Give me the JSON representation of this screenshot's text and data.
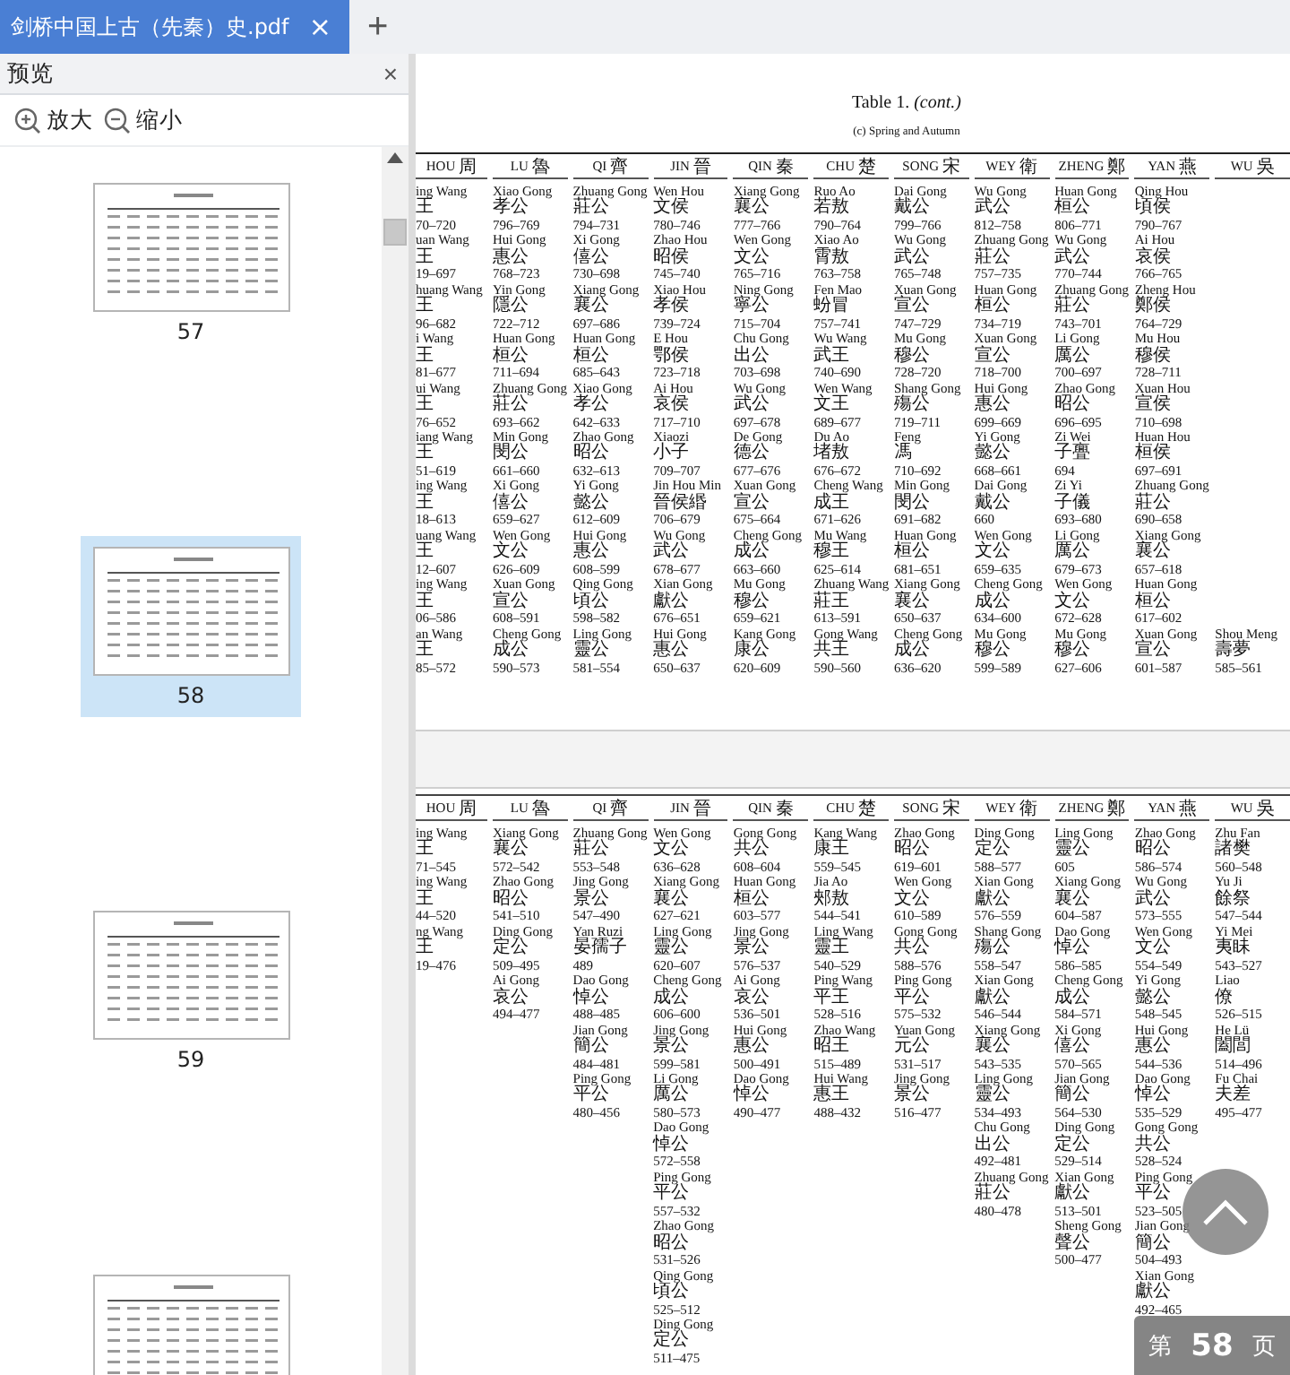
{
  "tabs": [
    {
      "title": "剑桥中国上古（先秦）史.pdf",
      "close": "×",
      "selected": true
    }
  ],
  "new_tab": "+",
  "sidebar": {
    "title": "预览",
    "close": "×",
    "tools": [
      {
        "kind": "zoom-in",
        "label": "放大"
      },
      {
        "kind": "zoom-out",
        "label": "缩小"
      }
    ],
    "thumbnails": [
      {
        "label": "57",
        "selected": false
      },
      {
        "label": "58",
        "selected": true
      },
      {
        "label": "59",
        "selected": false
      },
      {
        "selected": false
      }
    ]
  },
  "pages": [
    {
      "title": "Table 1. *(cont.)*",
      "subtitle": "(c) Spring and Autumn",
      "columns": [
        {
          "state": "HOU",
          "zh": "周",
          "entries": [
            [
              "ing Wang",
              "王",
              "70–720"
            ],
            [
              "uan Wang",
              "王",
              "19–697"
            ],
            [
              "huang Wang",
              "王",
              "96–682"
            ],
            [
              "i Wang",
              "王",
              "81–677"
            ],
            [
              "ui Wang",
              "王",
              "76–652"
            ],
            [
              "iang Wang",
              "王",
              "51–619"
            ],
            [
              "ing Wang",
              "王",
              "18–613"
            ],
            [
              "uang Wang",
              "王",
              "12–607"
            ],
            [
              "ing Wang",
              "王",
              "06–586"
            ],
            [
              "an Wang",
              "王",
              "85–572"
            ]
          ]
        },
        {
          "state": "LU",
          "zh": "魯",
          "entries": [
            [
              "Xiao Gong",
              "孝公",
              "796–769"
            ],
            [
              "Hui Gong",
              "惠公",
              "768–723"
            ],
            [
              "Yin Gong",
              "隱公",
              "722–712"
            ],
            [
              "Huan Gong",
              "桓公",
              "711–694"
            ],
            [
              "Zhuang Gong",
              "莊公",
              "693–662"
            ],
            [
              "Min Gong",
              "閔公",
              "661–660"
            ],
            [
              "Xi Gong",
              "僖公",
              "659–627"
            ],
            [
              "Wen Gong",
              "文公",
              "626–609"
            ],
            [
              "Xuan Gong",
              "宣公",
              "608–591"
            ],
            [
              "Cheng Gong",
              "成公",
              "590–573"
            ]
          ]
        },
        {
          "state": "QI",
          "zh": "齊",
          "entries": [
            [
              "Zhuang Gong",
              "莊公",
              "794–731"
            ],
            [
              "Xi Gong",
              "僖公",
              "730–698"
            ],
            [
              "Xiang Gong",
              "襄公",
              "697–686"
            ],
            [
              "Huan Gong",
              "桓公",
              "685–643"
            ],
            [
              "Xiao Gong",
              "孝公",
              "642–633"
            ],
            [
              "Zhao Gong",
              "昭公",
              "632–613"
            ],
            [
              "Yi Gong",
              "懿公",
              "612–609"
            ],
            [
              "Hui Gong",
              "惠公",
              "608–599"
            ],
            [
              "Qing Gong",
              "頃公",
              "598–582"
            ],
            [
              "Ling Gong",
              "靈公",
              "581–554"
            ]
          ]
        },
        {
          "state": "JIN",
          "zh": "晉",
          "entries": [
            [
              "Wen Hou",
              "文侯",
              "780–746"
            ],
            [
              "Zhao Hou",
              "昭侯",
              "745–740"
            ],
            [
              "Xiao Hou",
              "孝侯",
              "739–724"
            ],
            [
              "E Hou",
              "鄂侯",
              "723–718"
            ],
            [
              "Ai Hou",
              "哀侯",
              "717–710"
            ],
            [
              "Xiaozi",
              "小子",
              "709–707"
            ],
            [
              "Jin Hou Min",
              "晉侯緡",
              "706–679"
            ],
            [
              "Wu Gong",
              "武公",
              "678–677"
            ],
            [
              "Xian Gong",
              "獻公",
              "676–651"
            ],
            [
              "Hui Gong",
              "惠公",
              "650–637"
            ]
          ]
        },
        {
          "state": "QIN",
          "zh": "秦",
          "entries": [
            [
              "Xiang Gong",
              "襄公",
              "777–766"
            ],
            [
              "Wen Gong",
              "文公",
              "765–716"
            ],
            [
              "Ning Gong",
              "寧公",
              "715–704"
            ],
            [
              "Chu Gong",
              "出公",
              "703–698"
            ],
            [
              "Wu Gong",
              "武公",
              "697–678"
            ],
            [
              "De Gong",
              "德公",
              "677–676"
            ],
            [
              "Xuan Gong",
              "宣公",
              "675–664"
            ],
            [
              "Cheng Gong",
              "成公",
              "663–660"
            ],
            [
              "Mu Gong",
              "穆公",
              "659–621"
            ],
            [
              "Kang Gong",
              "康公",
              "620–609"
            ]
          ]
        },
        {
          "state": "CHU",
          "zh": "楚",
          "entries": [
            [
              "Ruo Ao",
              "若敖",
              "790–764"
            ],
            [
              "Xiao Ao",
              "霄敖",
              "763–758"
            ],
            [
              "Fen Mao",
              "蚡冒",
              "757–741"
            ],
            [
              "Wu Wang",
              "武王",
              "740–690"
            ],
            [
              "Wen Wang",
              "文王",
              "689–677"
            ],
            [
              "Du Ao",
              "堵敖",
              "676–672"
            ],
            [
              "Cheng Wang",
              "成王",
              "671–626"
            ],
            [
              "Mu Wang",
              "穆王",
              "625–614"
            ],
            [
              "Zhuang Wang",
              "莊王",
              "613–591"
            ],
            [
              "Gong Wang",
              "共王",
              "590–560"
            ]
          ]
        },
        {
          "state": "SONG",
          "zh": "宋",
          "entries": [
            [
              "Dai Gong",
              "戴公",
              "799–766"
            ],
            [
              "Wu Gong",
              "武公",
              "765–748"
            ],
            [
              "Xuan Gong",
              "宣公",
              "747–729"
            ],
            [
              "Mu Gong",
              "穆公",
              "728–720"
            ],
            [
              "Shang Gong",
              "殤公",
              "719–711"
            ],
            [
              "Feng",
              "馮",
              "710–692"
            ],
            [
              "Min Gong",
              "閔公",
              "691–682"
            ],
            [
              "Huan Gong",
              "桓公",
              "681–651"
            ],
            [
              "Xiang Gong",
              "襄公",
              "650–637"
            ],
            [
              "Cheng Gong",
              "成公",
              "636–620"
            ]
          ]
        },
        {
          "state": "WEY",
          "zh": "衛",
          "entries": [
            [
              "Wu Gong",
              "武公",
              "812–758"
            ],
            [
              "Zhuang Gong",
              "莊公",
              "757–735"
            ],
            [
              "Huan Gong",
              "桓公",
              "734–719"
            ],
            [
              "Xuan Gong",
              "宣公",
              "718–700"
            ],
            [
              "Hui Gong",
              "惠公",
              "699–669"
            ],
            [
              "Yi Gong",
              "懿公",
              "668–661"
            ],
            [
              "Dai Gong",
              "戴公",
              "660"
            ],
            [
              "Wen Gong",
              "文公",
              "659–635"
            ],
            [
              "Cheng Gong",
              "成公",
              "634–600"
            ],
            [
              "Mu Gong",
              "穆公",
              "599–589"
            ]
          ]
        },
        {
          "state": "ZHENG",
          "zh": "鄭",
          "entries": [
            [
              "Huan Gong",
              "桓公",
              "806–771"
            ],
            [
              "Wu Gong",
              "武公",
              "770–744"
            ],
            [
              "Zhuang Gong",
              "莊公",
              "743–701"
            ],
            [
              "Li Gong",
              "厲公",
              "700–697"
            ],
            [
              "Zhao Gong",
              "昭公",
              "696–695"
            ],
            [
              "Zi Wei",
              "子亹",
              "694"
            ],
            [
              "Zi Yi",
              "子儀",
              "693–680"
            ],
            [
              "Li Gong",
              "厲公",
              "679–673"
            ],
            [
              "Wen Gong",
              "文公",
              "672–628"
            ],
            [
              "Mu Gong",
              "穆公",
              "627–606"
            ]
          ]
        },
        {
          "state": "YAN",
          "zh": "燕",
          "entries": [
            [
              "Qing Hou",
              "頃侯",
              "790–767"
            ],
            [
              "Ai Hou",
              "哀侯",
              "766–765"
            ],
            [
              "Zheng Hou",
              "鄭侯",
              "764–729"
            ],
            [
              "Mu Hou",
              "穆侯",
              "728–711"
            ],
            [
              "Xuan Hou",
              "宣侯",
              "710–698"
            ],
            [
              "Huan Hou",
              "桓侯",
              "697–691"
            ],
            [
              "Zhuang Gong",
              "莊公",
              "690–658"
            ],
            [
              "Xiang Gong",
              "襄公",
              "657–618"
            ],
            [
              "Huan Gong",
              "桓公",
              "617–602"
            ],
            [
              "Xuan Gong",
              "宣公",
              "601–587"
            ]
          ]
        },
        {
          "state": "WU",
          "zh": "吳",
          "last_row_only": true,
          "entries": [
            [
              "Shou Meng",
              "壽夢",
              "585–561"
            ]
          ]
        }
      ]
    },
    {
      "columns": [
        {
          "state": "HOU",
          "zh": "周",
          "entries": [
            [
              "ing Wang",
              "王",
              "71–545"
            ],
            [
              "ing Wang",
              "王",
              "44–520"
            ],
            [
              "ng Wang",
              "王",
              "19–476"
            ]
          ]
        },
        {
          "state": "LU",
          "zh": "魯",
          "entries": [
            [
              "Xiang Gong",
              "襄公",
              "572–542"
            ],
            [
              "Zhao Gong",
              "昭公",
              "541–510"
            ],
            [
              "Ding Gong",
              "定公",
              "509–495"
            ],
            [
              "Ai Gong",
              "哀公",
              "494–477"
            ]
          ]
        },
        {
          "state": "QI",
          "zh": "齊",
          "entries": [
            [
              "Zhuang Gong",
              "莊公",
              "553–548"
            ],
            [
              "Jing Gong",
              "景公",
              "547–490"
            ],
            [
              "Yan Ruzi",
              "晏孺子",
              "489"
            ],
            [
              "Dao Gong",
              "悼公",
              "488–485"
            ],
            [
              "Jian Gong",
              "簡公",
              "484–481"
            ],
            [
              "Ping Gong",
              "平公",
              "480–456"
            ]
          ]
        },
        {
          "state": "JIN",
          "zh": "晉",
          "entries": [
            [
              "Wen Gong",
              "文公",
              "636–628"
            ],
            [
              "Xiang Gong",
              "襄公",
              "627–621"
            ],
            [
              "Ling Gong",
              "靈公",
              "620–607"
            ],
            [
              "Cheng Gong",
              "成公",
              "606–600"
            ],
            [
              "Jing Gong",
              "景公",
              "599–581"
            ],
            [
              "Li Gong",
              "厲公",
              "580–573"
            ],
            [
              "Dao Gong",
              "悼公",
              "572–558"
            ],
            [
              "Ping Gong",
              "平公",
              "557–532"
            ],
            [
              "Zhao Gong",
              "昭公",
              "531–526"
            ],
            [
              "Qing Gong",
              "頃公",
              "525–512"
            ],
            [
              "Ding Gong",
              "定公",
              "511–475"
            ]
          ]
        },
        {
          "state": "QIN",
          "zh": "秦",
          "entries": [
            [
              "Gong Gong",
              "共公",
              "608–604"
            ],
            [
              "Huan Gong",
              "桓公",
              "603–577"
            ],
            [
              "Jing Gong",
              "景公",
              "576–537"
            ],
            [
              "Ai Gong",
              "哀公",
              "536–501"
            ],
            [
              "Hui Gong",
              "惠公",
              "500–491"
            ],
            [
              "Dao Gong",
              "悼公",
              "490–477"
            ]
          ]
        },
        {
          "state": "CHU",
          "zh": "楚",
          "entries": [
            [
              "Kang Wang",
              "康王",
              "559–545"
            ],
            [
              "Jia Ao",
              "郟敖",
              "544–541"
            ],
            [
              "Ling Wang",
              "靈王",
              "540–529"
            ],
            [
              "Ping Wang",
              "平王",
              "528–516"
            ],
            [
              "Zhao Wang",
              "昭王",
              "515–489"
            ],
            [
              "Hui Wang",
              "惠王",
              "488–432"
            ]
          ]
        },
        {
          "state": "SONG",
          "zh": "宋",
          "entries": [
            [
              "Zhao Gong",
              "昭公",
              "619–601"
            ],
            [
              "Wen Gong",
              "文公",
              "610–589"
            ],
            [
              "Gong Gong",
              "共公",
              "588–576"
            ],
            [
              "Ping Gong",
              "平公",
              "575–532"
            ],
            [
              "Yuan Gong",
              "元公",
              "531–517"
            ],
            [
              "Jing Gong",
              "景公",
              "516–477"
            ]
          ]
        },
        {
          "state": "WEY",
          "zh": "衛",
          "entries": [
            [
              "Ding Gong",
              "定公",
              "588–577"
            ],
            [
              "Xian Gong",
              "獻公",
              "576–559"
            ],
            [
              "Shang Gong",
              "殤公",
              "558–547"
            ],
            [
              "Xian Gong",
              "獻公",
              "546–544"
            ],
            [
              "Xiang Gong",
              "襄公",
              "543–535"
            ],
            [
              "Ling Gong",
              "靈公",
              "534–493"
            ],
            [
              "Chu Gong",
              "出公",
              "492–481"
            ],
            [
              "Zhuang Gong",
              "莊公",
              "480–478"
            ]
          ]
        },
        {
          "state": "ZHENG",
          "zh": "鄭",
          "entries": [
            [
              "Ling Gong",
              "靈公",
              "605"
            ],
            [
              "Xiang Gong",
              "襄公",
              "604–587"
            ],
            [
              "Dao Gong",
              "悼公",
              "586–585"
            ],
            [
              "Cheng Gong",
              "成公",
              "584–571"
            ],
            [
              "Xi Gong",
              "僖公",
              "570–565"
            ],
            [
              "Jian Gong",
              "簡公",
              "564–530"
            ],
            [
              "Ding Gong",
              "定公",
              "529–514"
            ],
            [
              "Xian Gong",
              "獻公",
              "513–501"
            ],
            [
              "Sheng Gong",
              "聲公",
              "500–477"
            ]
          ]
        },
        {
          "state": "YAN",
          "zh": "燕",
          "entries": [
            [
              "Zhao Gong",
              "昭公",
              "586–574"
            ],
            [
              "Wu Gong",
              "武公",
              "573–555"
            ],
            [
              "Wen Gong",
              "文公",
              "554–549"
            ],
            [
              "Yi Gong",
              "懿公",
              "548–545"
            ],
            [
              "Hui Gong",
              "惠公",
              "544–536"
            ],
            [
              "Dao Gong",
              "悼公",
              "535–529"
            ],
            [
              "Gong Gong",
              "共公",
              "528–524"
            ],
            [
              "Ping Gong",
              "平公",
              "523–505"
            ],
            [
              "Jian Gong",
              "簡公",
              "504–493"
            ],
            [
              "Xian Gong",
              "獻公",
              "492–465"
            ]
          ]
        },
        {
          "state": "WU",
          "zh": "吳",
          "entries": [
            [
              "Zhu Fan",
              "諸樊",
              "560–548"
            ],
            [
              "Yu Ji",
              "餘祭",
              "547–544"
            ],
            [
              "Yi Mei",
              "夷眛",
              "543–527"
            ],
            [
              "Liao",
              "僚",
              "526–515"
            ],
            [
              "He Lü",
              "闔閭",
              "514–496"
            ],
            [
              "Fu Chai",
              "夫差",
              "495–477"
            ]
          ]
        }
      ]
    }
  ],
  "page_indicator": {
    "prefix": "第",
    "number": "58",
    "suffix": "页"
  }
}
